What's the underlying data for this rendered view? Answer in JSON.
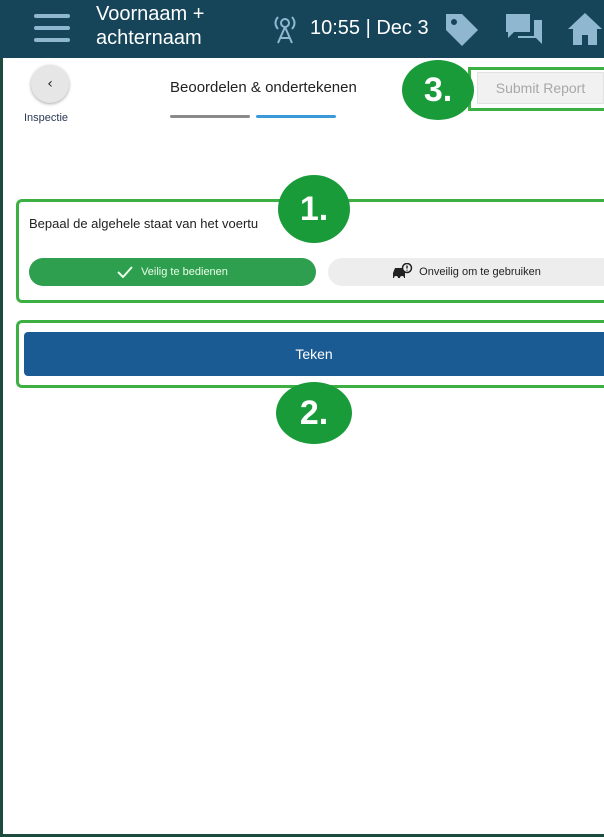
{
  "topbar": {
    "user_name": "Voornaam + achternaam",
    "status": "10:55 | Dec 3",
    "icons": [
      "menu-icon",
      "signal-tower-icon",
      "tag-icon",
      "chat-icon",
      "home-icon"
    ],
    "background": "#16455a"
  },
  "header": {
    "back_label": "Inspectie",
    "back_glyph": "‹",
    "title": "Beoordelen & ondertekenen",
    "submit_label": "Submit Report"
  },
  "condition": {
    "question": "Bepaal de algehele staat van het voertu",
    "safe_label": "Veilig te bedienen",
    "unsafe_label": "Onveilig om te gebruiken",
    "selected": "safe"
  },
  "sign": {
    "label": "Teken"
  },
  "badges": {
    "one": "1.",
    "two": "2.",
    "three": "3."
  },
  "colors": {
    "badge": "#199b3a",
    "highlight": "#3cb043",
    "primary": "#1b5b94",
    "safe": "#2e9e4f"
  }
}
